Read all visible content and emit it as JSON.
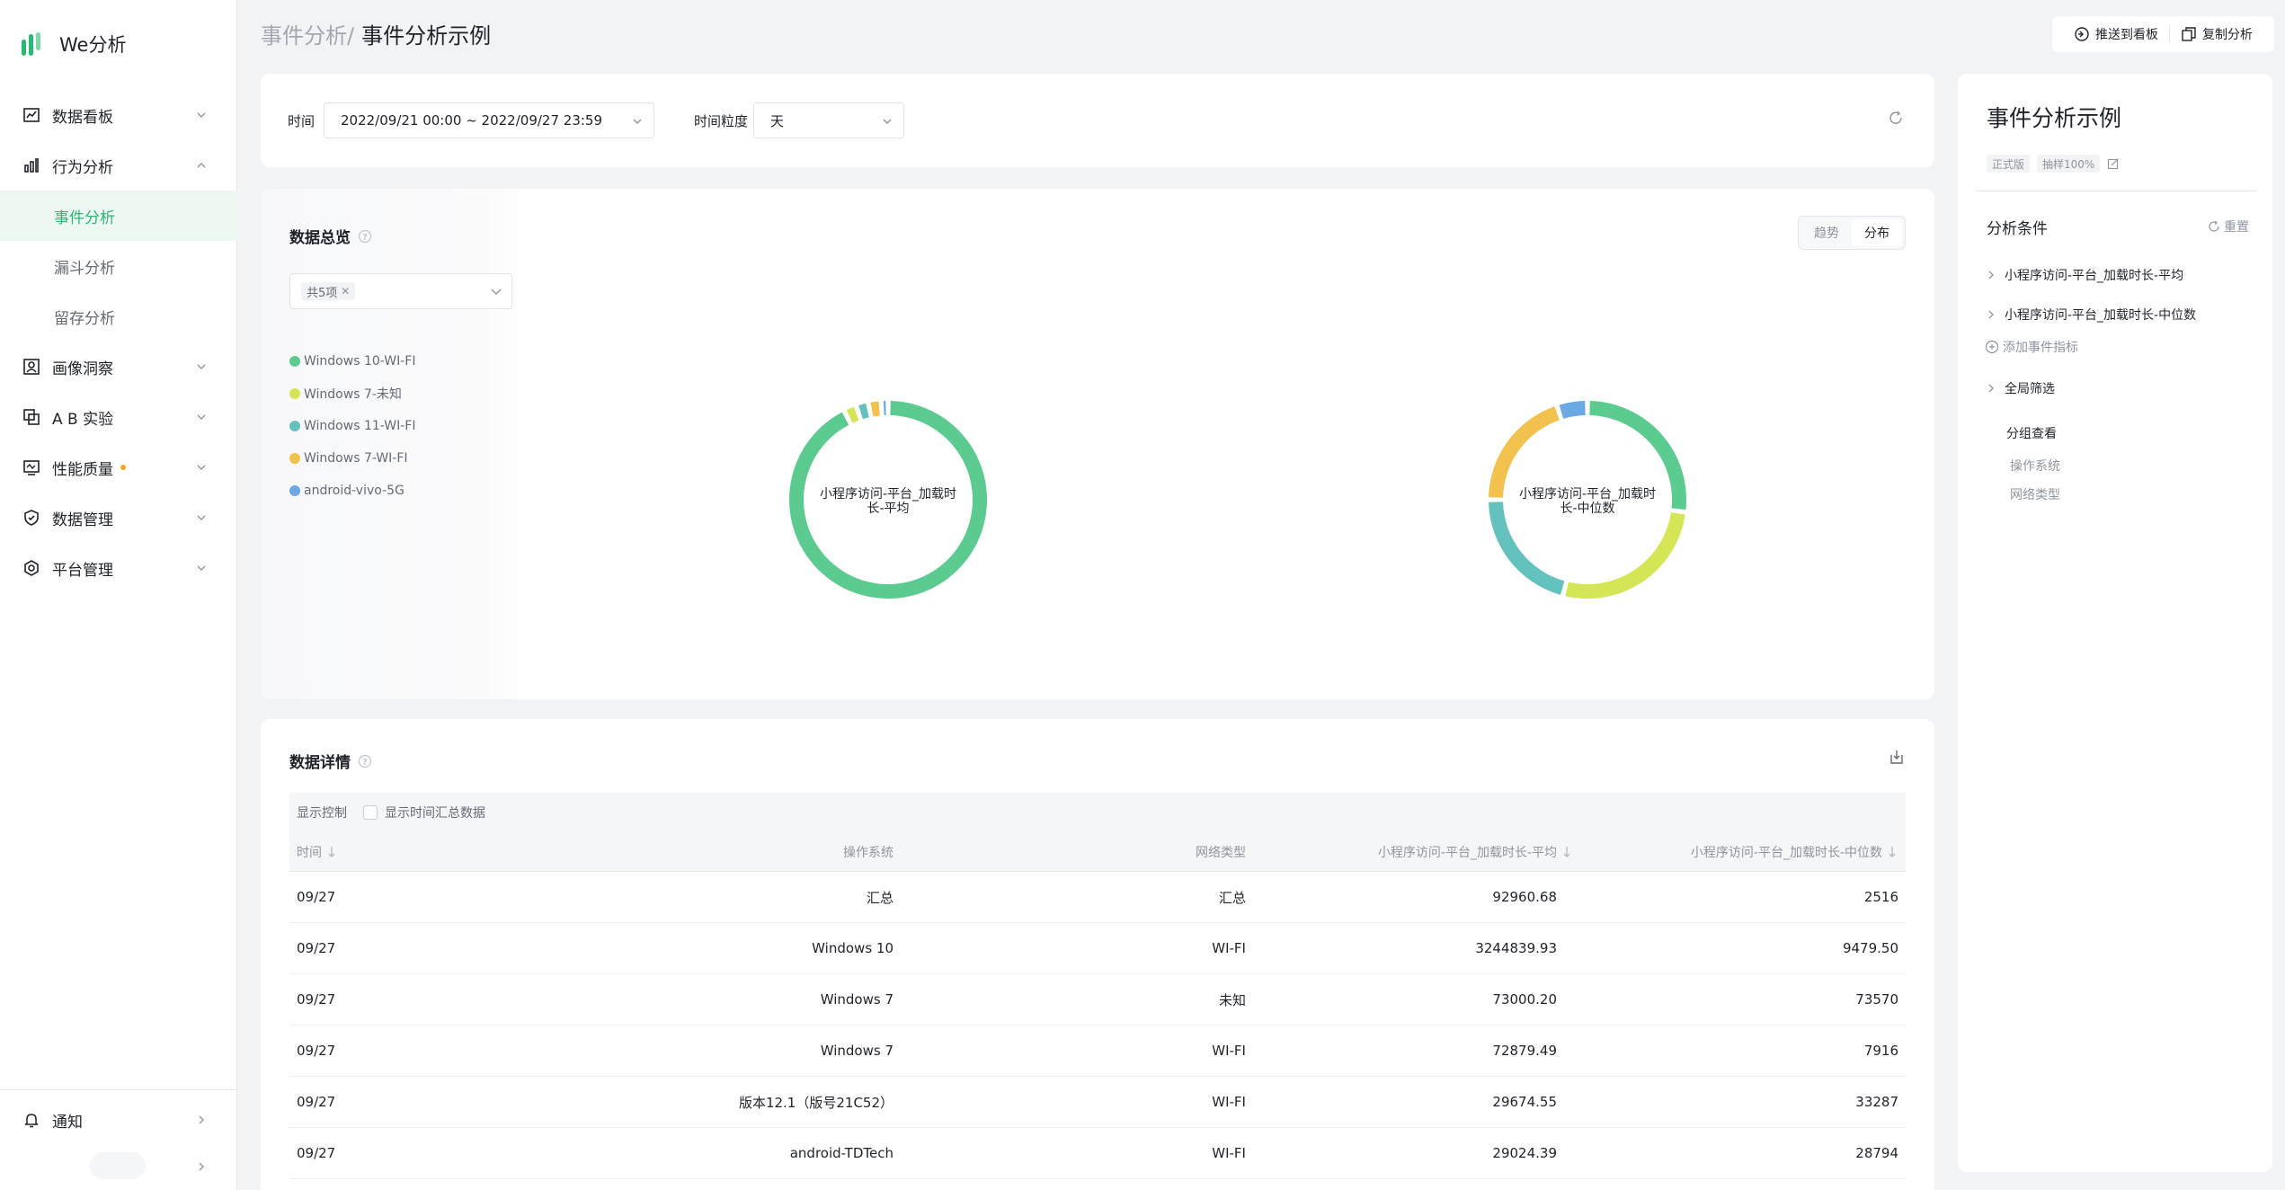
{
  "app": {
    "name": "We分析"
  },
  "sidebar": {
    "items": [
      {
        "label": "数据看板",
        "icon": "chart-board-icon"
      },
      {
        "label": "行为分析",
        "icon": "bar-chart-icon",
        "expanded": true,
        "children": [
          {
            "label": "事件分析",
            "active": true
          },
          {
            "label": "漏斗分析"
          },
          {
            "label": "留存分析"
          }
        ]
      },
      {
        "label": "画像洞察",
        "icon": "portrait-icon"
      },
      {
        "label": "A B 实验",
        "icon": "copy-squares-icon"
      },
      {
        "label": "性能质量",
        "icon": "monitor-icon",
        "badge_dot": true
      },
      {
        "label": "数据管理",
        "icon": "shield-check-icon"
      },
      {
        "label": "平台管理",
        "icon": "hexagon-gear-icon"
      }
    ],
    "notify": {
      "label": "通知",
      "icon": "bell-icon"
    }
  },
  "header": {
    "breadcrumb_parent": "事件分析/",
    "breadcrumb_current": "事件分析示例",
    "actions": {
      "push": "推送到看板",
      "copy": "复制分析"
    }
  },
  "filters": {
    "time_label": "时间",
    "time_value": "2022/09/21 00:00 ~ 2022/09/27 23:59",
    "granularity_label": "时间粒度",
    "granularity_value": "天"
  },
  "overview": {
    "title": "数据总览",
    "selector_tag": "共5项",
    "toggle": {
      "trend": "趋势",
      "distribution": "分布",
      "active": "distribution"
    },
    "legend": [
      {
        "label": "Windows 10-WI-FI",
        "color": "#5ccb8f"
      },
      {
        "label": "Windows 7-未知",
        "color": "#d4e656"
      },
      {
        "label": "Windows 11-WI-FI",
        "color": "#63c2bd"
      },
      {
        "label": "Windows 7-WI-FI",
        "color": "#f2c14e"
      },
      {
        "label": "android-vivo-5G",
        "color": "#6aa9e3"
      }
    ]
  },
  "chart_data": [
    {
      "type": "pie",
      "title": "小程序访问-平台_加载时长-平均",
      "labels": [
        "Windows 10-WI-FI",
        "Windows 7-未知",
        "Windows 11-WI-FI",
        "Windows 7-WI-FI",
        "android-vivo-5G"
      ],
      "values": [
        3244839.93,
        73000.2,
        70000,
        72879.49,
        40000
      ],
      "colors": [
        "#5ccb8f",
        "#d4e656",
        "#63c2bd",
        "#f2c14e",
        "#6aa9e3"
      ]
    },
    {
      "type": "pie",
      "title": "小程序访问-平台_加载时长-中位数",
      "labels": [
        "Windows 10-WI-FI",
        "Windows 7-未知",
        "Windows 11-WI-FI",
        "Windows 7-WI-FI",
        "android-vivo-5G"
      ],
      "values": [
        9479.5,
        73570,
        7200,
        7916,
        2000
      ],
      "colors": [
        "#5ccb8f",
        "#d4e656",
        "#63c2bd",
        "#f2c14e",
        "#6aa9e3"
      ],
      "display_shares": [
        0.27,
        0.27,
        0.21,
        0.2,
        0.05
      ]
    }
  ],
  "details": {
    "title": "数据详情",
    "control_label": "显示控制",
    "checkbox_label": "显示时间汇总数据",
    "columns": [
      "时间",
      "操作系统",
      "网络类型",
      "小程序访问-平台_加载时长-平均",
      "小程序访问-平台_加载时长-中位数"
    ],
    "rows": [
      [
        "09/27",
        "汇总",
        "汇总",
        "92960.68",
        "2516"
      ],
      [
        "09/27",
        "Windows 10",
        "WI-FI",
        "3244839.93",
        "9479.50"
      ],
      [
        "09/27",
        "Windows 7",
        "未知",
        "73000.20",
        "73570"
      ],
      [
        "09/27",
        "Windows 7",
        "WI-FI",
        "72879.49",
        "7916"
      ],
      [
        "09/27",
        "版本12.1（版号21C52）",
        "WI-FI",
        "29674.55",
        "33287"
      ],
      [
        "09/27",
        "android-TDTech",
        "WI-FI",
        "29024.39",
        "28794"
      ]
    ]
  },
  "right_panel": {
    "title": "事件分析示例",
    "tags": [
      "正式版",
      "抽样100%"
    ],
    "conditions_title": "分析条件",
    "reset_label": "重置",
    "metrics": [
      "小程序访问-平台_加载时长-平均",
      "小程序访问-平台_加载时长-中位数"
    ],
    "add_metric": "添加事件指标",
    "global_filter": "全局筛选",
    "group_title": "分组查看",
    "group_items": [
      "操作系统",
      "网络类型"
    ]
  }
}
